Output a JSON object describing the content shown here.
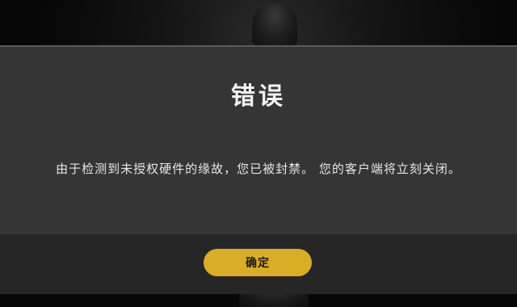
{
  "dialog": {
    "title": "错误",
    "message": "由于检测到未授权硬件的缘故，您已被封禁。 您的客户端将立刻关闭。",
    "confirm_label": "确定"
  },
  "colors": {
    "dialog_background": "#353535",
    "footer_background": "#262626",
    "button_accent": "#d9ad26",
    "title_text": "#f2f2f2"
  }
}
